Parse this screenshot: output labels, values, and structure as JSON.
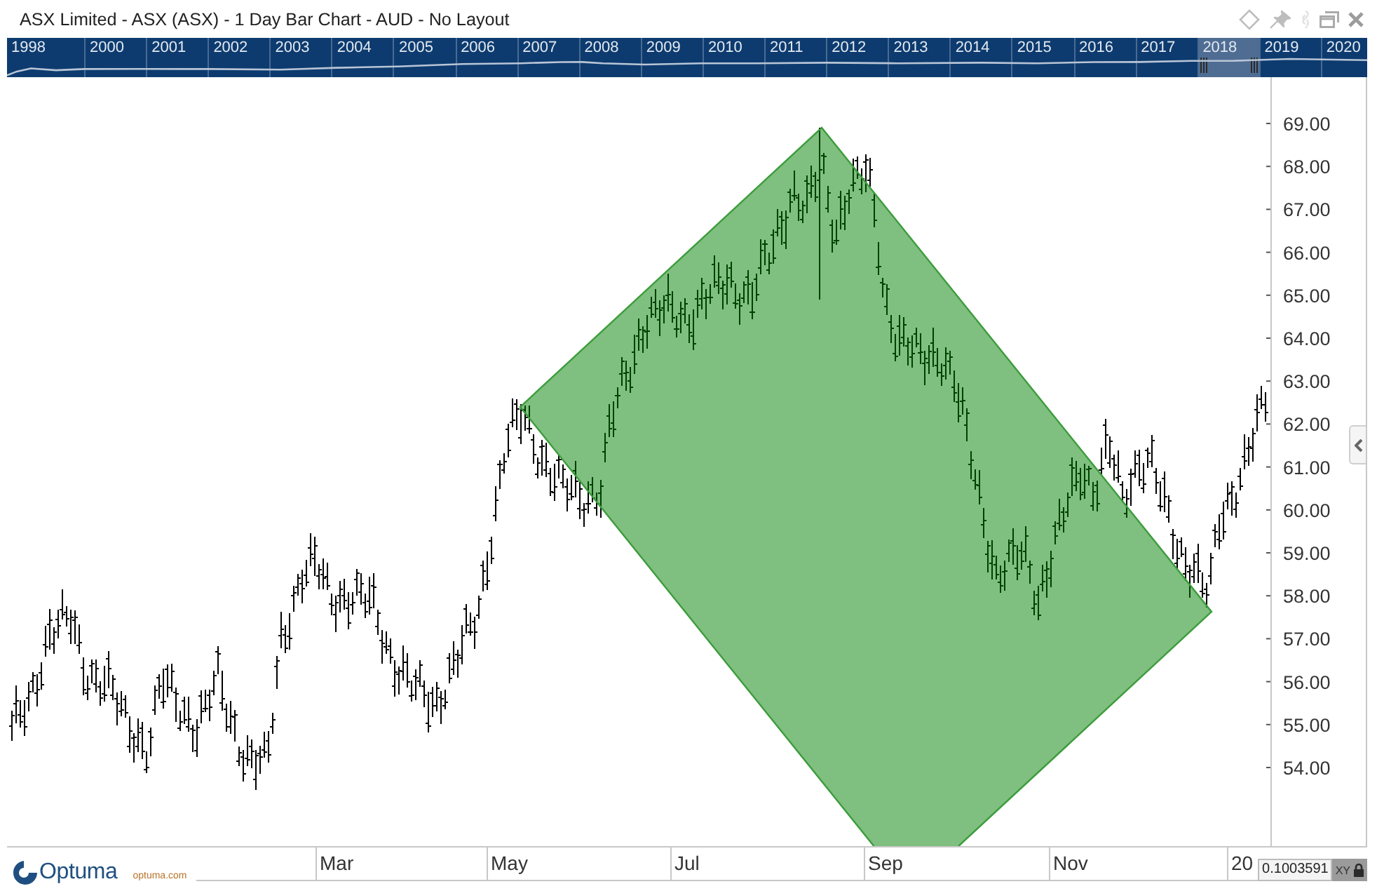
{
  "window": {
    "title": "ASX Limited - ASX (ASX) - 1 Day Bar Chart - AUD - No Layout"
  },
  "navigator": {
    "years": [
      {
        "label": "1998",
        "selected": false
      },
      {
        "label": "2000",
        "selected": false
      },
      {
        "label": "2001",
        "selected": false
      },
      {
        "label": "2002",
        "selected": false
      },
      {
        "label": "2003",
        "selected": false
      },
      {
        "label": "2004",
        "selected": false
      },
      {
        "label": "2005",
        "selected": false
      },
      {
        "label": "2006",
        "selected": false
      },
      {
        "label": "2007",
        "selected": false
      },
      {
        "label": "2008",
        "selected": false
      },
      {
        "label": "2009",
        "selected": false
      },
      {
        "label": "2010",
        "selected": false
      },
      {
        "label": "2011",
        "selected": false
      },
      {
        "label": "2012",
        "selected": false
      },
      {
        "label": "2013",
        "selected": false
      },
      {
        "label": "2014",
        "selected": false
      },
      {
        "label": "2015",
        "selected": false
      },
      {
        "label": "2016",
        "selected": false
      },
      {
        "label": "2017",
        "selected": false
      },
      {
        "label": "2018",
        "selected": true
      },
      {
        "label": "2019",
        "selected": false
      },
      {
        "label": "2020",
        "selected": false
      }
    ]
  },
  "price_axis": {
    "labels": [
      "69.00",
      "68.00",
      "67.00",
      "66.00",
      "65.00",
      "64.00",
      "63.00",
      "62.00",
      "61.00",
      "60.00",
      "59.00",
      "58.00",
      "57.00",
      "56.00",
      "55.00",
      "54.00"
    ]
  },
  "time_axis": {
    "labels": [
      "Mar",
      "May",
      "Jul",
      "Sep",
      "Nov",
      "20"
    ]
  },
  "logo": {
    "name": "Optuma",
    "website": "optuma.com"
  },
  "cursor_readout": {
    "value": "0.1003591",
    "mode": "XY"
  }
}
